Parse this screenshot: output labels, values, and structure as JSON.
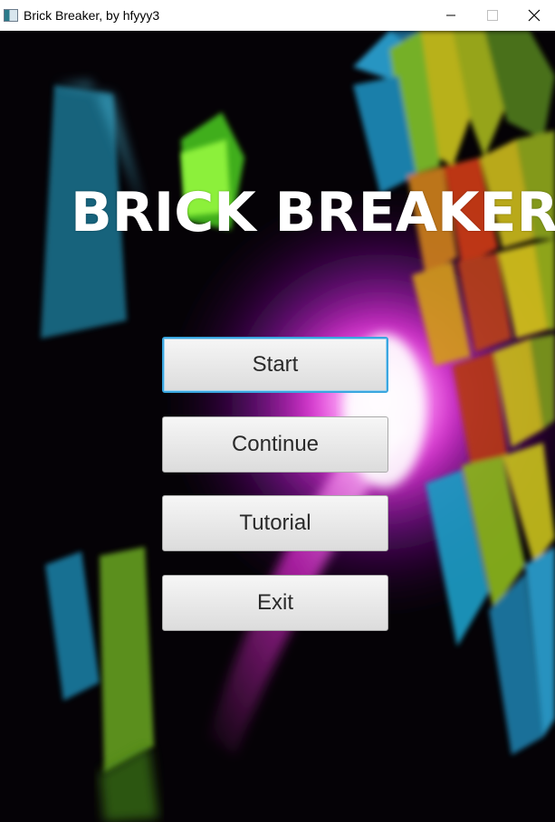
{
  "window": {
    "title": "Brick Breaker, by hfyyy3",
    "icon": "app-window-icon",
    "controls": [
      "minimize-icon",
      "maximize-icon",
      "close-icon"
    ]
  },
  "game": {
    "title": "BRICK BREAKER",
    "menu": {
      "start": "Start",
      "continue": "Continue",
      "tutorial": "Tutorial",
      "exit": "Exit",
      "focused": "Start"
    }
  },
  "colors": {
    "focus_border": "#3aa6df",
    "glow": "#ff33ff",
    "background": "#050206"
  }
}
